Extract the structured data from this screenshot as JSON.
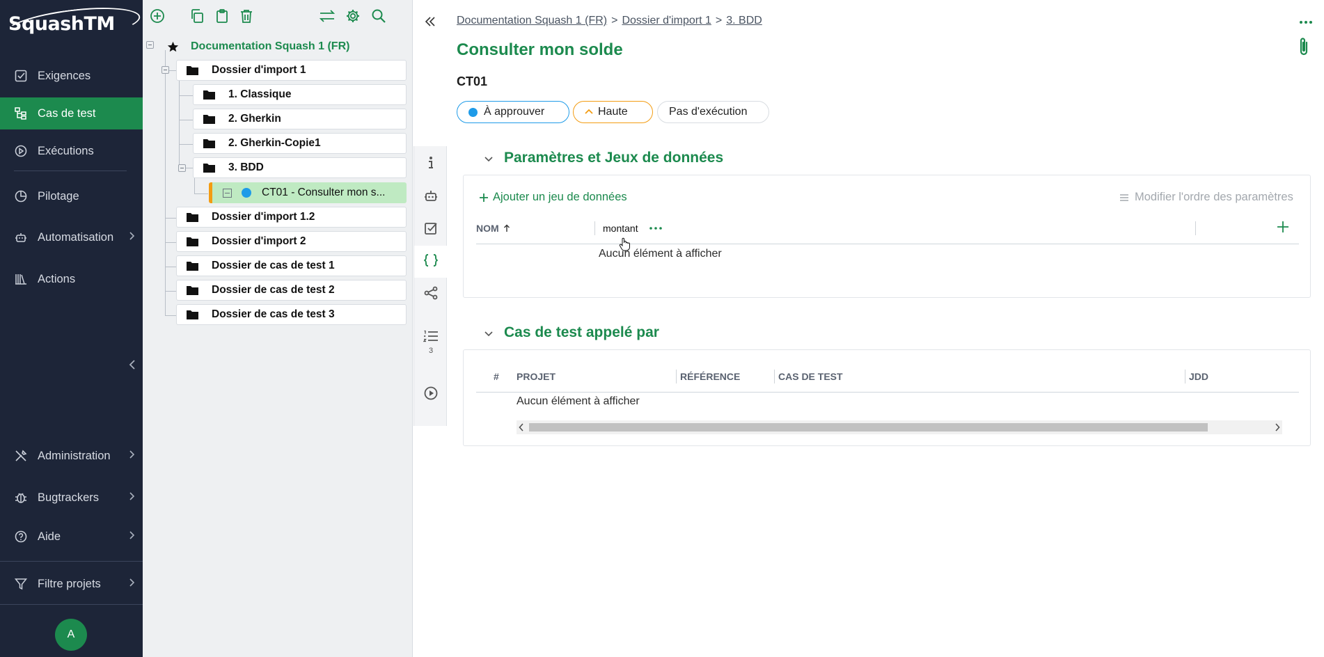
{
  "app": {
    "logo": "SquashTM"
  },
  "nav": {
    "items": [
      {
        "label": "Exigences",
        "icon": "checkbox-icon"
      },
      {
        "label": "Cas de test",
        "icon": "tree-icon"
      },
      {
        "label": "Exécutions",
        "icon": "play-circle-icon"
      },
      {
        "label": "Pilotage",
        "icon": "pie-chart-icon"
      },
      {
        "label": "Automatisation",
        "icon": "robot-icon"
      },
      {
        "label": "Actions",
        "icon": "books-icon"
      },
      {
        "label": "Administration",
        "icon": "tools-icon"
      },
      {
        "label": "Bugtrackers",
        "icon": "bug-icon"
      },
      {
        "label": "Aide",
        "icon": "help-icon"
      },
      {
        "label": "Filtre projets",
        "icon": "filter-icon"
      }
    ],
    "active": "Cas de test",
    "avatar": "A"
  },
  "tree": {
    "project": "Documentation Squash 1 (FR)",
    "nodes": [
      {
        "label": "Dossier d'import 1"
      },
      {
        "label": "1. Classique"
      },
      {
        "label": "2. Gherkin"
      },
      {
        "label": "2. Gherkin-Copie1"
      },
      {
        "label": "3. BDD"
      },
      {
        "label": "CT01 - Consulter mon s..."
      },
      {
        "label": "Dossier d'import 1.2"
      },
      {
        "label": "Dossier d'import 2"
      },
      {
        "label": "Dossier de cas de test 1"
      },
      {
        "label": "Dossier de cas de test 2"
      },
      {
        "label": "Dossier de cas de test 3"
      }
    ]
  },
  "breadcrumb": [
    "Documentation Squash 1 (FR)",
    "Dossier d'import 1",
    "3. BDD"
  ],
  "breadcrumb_sep": ">",
  "page": {
    "title": "Consulter mon solde",
    "reference": "CT01",
    "status": "À approuver",
    "importance": "Haute",
    "execution": "Pas d'exécution",
    "colors": {
      "accent": "#1c8a4e",
      "status_blue": "#1e9be8",
      "importance_orange": "#f39c12",
      "nav_bg": "#1d2538"
    }
  },
  "vtool": {
    "list_count": "3"
  },
  "params_section": {
    "title": "Paramètres et Jeux de données",
    "add_label": "Ajouter un jeu de données",
    "reorder_label": "Modifier l'ordre des paramètres",
    "col_name": "NOM",
    "col_param": "montant",
    "empty": "Aucun élément à afficher"
  },
  "called_section": {
    "title": "Cas de test appelé par",
    "col_num": "#",
    "col_project": "PROJET",
    "col_reference": "RÉFÉRENCE",
    "col_testcase": "CAS DE TEST",
    "col_jdd": "JDD",
    "empty": "Aucun élément à afficher"
  }
}
